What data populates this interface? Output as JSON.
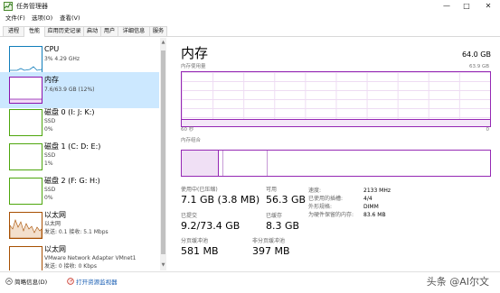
{
  "window": {
    "title": "任务管理器",
    "controls": {
      "minimize": "—",
      "maximize": "□",
      "close": "✕"
    }
  },
  "menu": [
    "文件(F)",
    "选项(O)",
    "查看(V)"
  ],
  "tabs": [
    "进程",
    "性能",
    "应用历史记录",
    "启动",
    "用户",
    "详细信息",
    "服务"
  ],
  "active_tab": "性能",
  "sidebar": [
    {
      "title": "CPU",
      "lines": [
        "3% 4.29 GHz"
      ],
      "color": "#117dbb",
      "selected": false
    },
    {
      "title": "内存",
      "lines": [
        "7.6/63.9 GB (12%)"
      ],
      "color": "#8b12ae",
      "selected": true
    },
    {
      "title": "磁盘 0 (I: J: K:)",
      "lines": [
        "SSD",
        "0%"
      ],
      "color": "#4da60c",
      "selected": false
    },
    {
      "title": "磁盘 1 (C: D: E:)",
      "lines": [
        "SSD",
        "1%"
      ],
      "color": "#4da60c",
      "selected": false
    },
    {
      "title": "磁盘 2 (F: G: H:)",
      "lines": [
        "SSD",
        "0%"
      ],
      "color": "#4da60c",
      "selected": false
    },
    {
      "title": "以太网",
      "lines": [
        "以太网",
        "发送: 0.1  接收: 5.1 Mbps"
      ],
      "color": "#a74f01",
      "selected": false
    },
    {
      "title": "以太网",
      "lines": [
        "VMware Network Adapter VMnet1",
        "发送: 0  接收: 0 Kbps"
      ],
      "color": "#a74f01",
      "selected": false
    }
  ],
  "main": {
    "title": "内存",
    "total": "64.0 GB",
    "usage_label": "内存使用量",
    "usage_max": "63.9 GB",
    "usage_fraction": 0.12,
    "time_left": "60 秒",
    "time_right": "0",
    "composition_label": "内存组合",
    "stats": {
      "in_use_label": "使用中(已压缩)",
      "in_use": "7.1 GB (3.8 MB)",
      "available_label": "可用",
      "available": "56.3 GB",
      "committed_label": "已提交",
      "committed": "9.2/73.4 GB",
      "cached_label": "已缓存",
      "cached": "8.3 GB",
      "paged_label": "分页缓冲池",
      "paged": "581 MB",
      "nonpaged_label": "非分页缓冲池",
      "nonpaged": "397 MB"
    },
    "specs": [
      {
        "k": "速度:",
        "v": "2133 MHz"
      },
      {
        "k": "已使用的插槽:",
        "v": "4/4"
      },
      {
        "k": "外形规格:",
        "v": "DIMM"
      },
      {
        "k": "为硬件保留的内存:",
        "v": "83.6 MB"
      }
    ]
  },
  "bottom": {
    "fewer_details": "简略信息(D)",
    "open_monitor": "打开资源监视器"
  },
  "watermark": "头条 @AI尔文"
}
